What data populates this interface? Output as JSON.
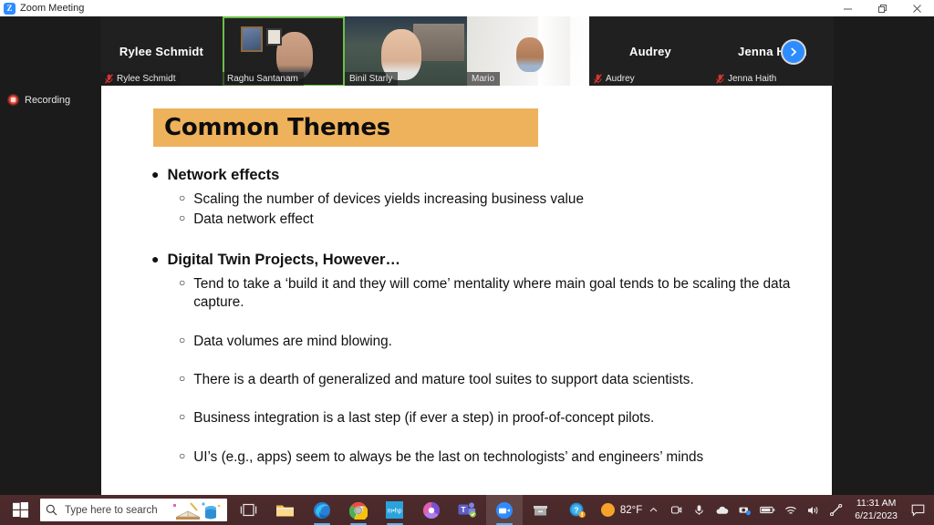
{
  "window": {
    "title": "Zoom Meeting",
    "app_icon": "zoom-logo-icon",
    "controls": {
      "minimize": "minimize-icon",
      "restore": "restore-icon",
      "close": "close-icon"
    }
  },
  "filmstrip": {
    "next_page_label": "next-page-icon",
    "tiles": [
      {
        "display_name": "Rylee Schmidt",
        "label": "Rylee Schmidt",
        "video_on": false,
        "muted": true,
        "active_speaker": false,
        "initials": "Rylee Schmidt"
      },
      {
        "display_name": "Raghu Santanam",
        "label": "Raghu Santanam",
        "video_on": true,
        "muted": false,
        "active_speaker": true,
        "initials": ""
      },
      {
        "display_name": "Binil Starly",
        "label": "Binil Starly",
        "video_on": true,
        "muted": false,
        "active_speaker": false,
        "initials": ""
      },
      {
        "display_name": "Mario",
        "label": "Mario",
        "video_on": true,
        "muted": false,
        "active_speaker": false,
        "initials": ""
      },
      {
        "display_name": "Audrey",
        "label": "Audrey",
        "video_on": false,
        "muted": true,
        "active_speaker": false,
        "initials": "Audrey"
      },
      {
        "display_name": "Jenna Haith",
        "label": "Jenna Haith",
        "video_on": false,
        "muted": true,
        "active_speaker": false,
        "initials": "Jenna Haith"
      }
    ]
  },
  "recording": {
    "label": "Recording",
    "icon": "recording-dot-icon"
  },
  "slide": {
    "title": "Common Themes",
    "title_bg": "#eeb25c",
    "sections": [
      {
        "heading": "Network effects",
        "items": [
          "Scaling the number of devices yields increasing business value",
          "Data network effect"
        ]
      },
      {
        "heading": "Digital Twin Projects, However…",
        "items": [
          "Tend to take a ‘build it and they will come’ mentality where main goal tends to be scaling the data capture.",
          "Data volumes are mind blowing.",
          "There is a dearth of generalized and mature tool suites to support data scientists.",
          "Business integration is a last step (if ever a step) in proof-of-concept pilots.",
          "UI’s (e.g., apps) seem to always be the last on technologists’ and engineers’ minds"
        ]
      }
    ]
  },
  "taskbar": {
    "start": "windows-start-icon",
    "search": {
      "placeholder": "Type here to search",
      "icon": "search-icon"
    },
    "apps": [
      {
        "name": "task-view-icon",
        "label": "Task View"
      },
      {
        "name": "file-explorer-icon",
        "label": "File Explorer"
      },
      {
        "name": "microsoft-edge-icon",
        "label": "Microsoft Edge"
      },
      {
        "name": "google-chrome-icon",
        "label": "Google Chrome"
      },
      {
        "name": "blue-app-icon",
        "label": "App"
      },
      {
        "name": "power-bi-icon",
        "label": "Power BI"
      },
      {
        "name": "microsoft-teams-icon",
        "label": "Microsoft Teams"
      },
      {
        "name": "zoom-app-icon",
        "label": "Zoom"
      },
      {
        "name": "archive-app-icon",
        "label": "App"
      },
      {
        "name": "help-app-icon",
        "label": "Get Help"
      }
    ],
    "weather": {
      "temperature": "82°F",
      "icon": "sun-icon"
    },
    "tray": [
      "chevron-up-icon",
      "camera-icon",
      "microphone-icon",
      "onedrive-icon",
      "webcam-icon",
      "battery-icon",
      "wifi-icon",
      "volume-icon",
      "pen-icon"
    ],
    "clock": {
      "time": "11:31 AM",
      "date": "6/21/2023"
    },
    "notifications": "notification-icon"
  }
}
